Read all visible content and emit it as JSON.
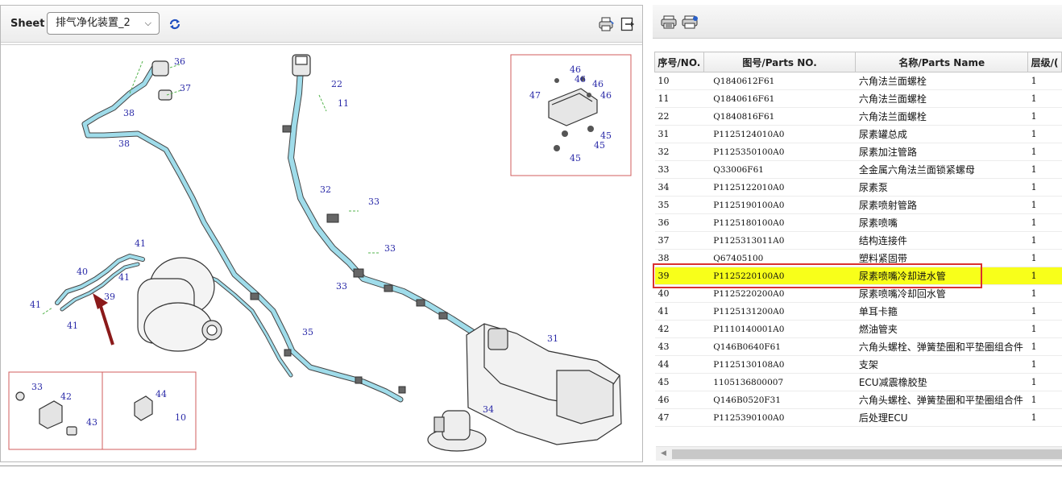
{
  "sheet": {
    "label": "Sheet",
    "selected": "排气净化装置_2"
  },
  "diagram": {
    "callouts": [
      "36",
      "37",
      "38",
      "38",
      "22",
      "11",
      "46",
      "46",
      "46",
      "46",
      "47",
      "45",
      "45",
      "45",
      "32",
      "33",
      "33",
      "33",
      "41",
      "40",
      "41",
      "39",
      "41",
      "41",
      "35",
      "31",
      "34",
      "33",
      "42",
      "43",
      "44",
      "10"
    ]
  },
  "table": {
    "headers": [
      "序号/NO.",
      "图号/Parts NO.",
      "名称/Parts Name",
      "层级/("
    ],
    "rows": [
      {
        "no": "10",
        "pn": "Q1840612F61",
        "name": "六角法兰面螺栓",
        "level": "1"
      },
      {
        "no": "11",
        "pn": "Q1840616F61",
        "name": "六角法兰面螺栓",
        "level": "1"
      },
      {
        "no": "22",
        "pn": "Q1840816F61",
        "name": "六角法兰面螺栓",
        "level": "1"
      },
      {
        "no": "31",
        "pn": "P1125124010A0",
        "name": "尿素罐总成",
        "level": "1"
      },
      {
        "no": "32",
        "pn": "P1125350100A0",
        "name": "尿素加注管路",
        "level": "1"
      },
      {
        "no": "33",
        "pn": "Q33006F61",
        "name": "全金属六角法兰面锁紧螺母",
        "level": "1"
      },
      {
        "no": "34",
        "pn": "P1125122010A0",
        "name": "尿素泵",
        "level": "1"
      },
      {
        "no": "35",
        "pn": "P1125190100A0",
        "name": "尿素喷射管路",
        "level": "1"
      },
      {
        "no": "36",
        "pn": "P1125180100A0",
        "name": "尿素喷嘴",
        "level": "1"
      },
      {
        "no": "37",
        "pn": "P1125313011A0",
        "name": "结构连接件",
        "level": "1"
      },
      {
        "no": "38",
        "pn": "Q67405100",
        "name": "塑料紧固带",
        "level": "1"
      },
      {
        "no": "39",
        "pn": "P1125220100A0",
        "name": "尿素喷嘴冷却进水管",
        "level": "1",
        "selected": true
      },
      {
        "no": "40",
        "pn": "P1125220200A0",
        "name": "尿素喷嘴冷却回水管",
        "level": "1"
      },
      {
        "no": "41",
        "pn": "P1125131200A0",
        "name": "单耳卡箍",
        "level": "1"
      },
      {
        "no": "42",
        "pn": "P1110140001A0",
        "name": "燃油管夹",
        "level": "1"
      },
      {
        "no": "43",
        "pn": "Q146B0640F61",
        "name": "六角头螺栓、弹簧垫圈和平垫圈组合件",
        "level": "1"
      },
      {
        "no": "44",
        "pn": "P1125130108A0",
        "name": "支架",
        "level": "1"
      },
      {
        "no": "45",
        "pn": "1105136800007",
        "name": "ECU减震橡胶垫",
        "level": "1"
      },
      {
        "no": "46",
        "pn": "Q146B0520F31",
        "name": "六角头螺栓、弹簧垫圈和平垫圈组合件",
        "level": "1"
      },
      {
        "no": "47",
        "pn": "P1125390100A0",
        "name": "后处理ECU",
        "level": "1"
      }
    ]
  },
  "colors": {
    "highlight_row": "#f8ff1a",
    "highlight_border": "#d9302f",
    "pipe": "#8fd8e8",
    "callout_text": "#2a2aa8",
    "arrow": "#8b1a1a"
  },
  "icons": {
    "refresh": "refresh-icon",
    "print": "print-icon",
    "exit": "exit-icon",
    "print_table": "print-table-icon",
    "export_table": "export-table-icon"
  }
}
